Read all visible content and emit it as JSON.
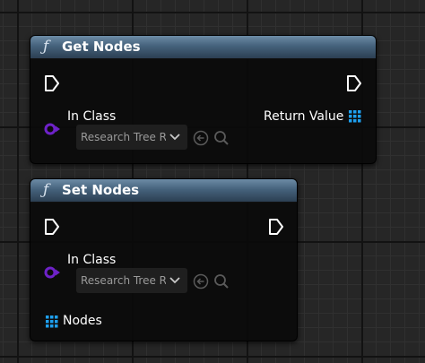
{
  "colors": {
    "graph_background": "#262626",
    "header_gradient_top": "#6c8ba5",
    "header_gradient_bottom": "#2c3f52",
    "class_pin": "#6e22c8",
    "array_pin": "#1ea0f0",
    "exec_pin": "#ffffff"
  },
  "get_node": {
    "title": "Get Nodes",
    "icon": "function-icon",
    "input_label": "In Class",
    "class_value": "Research Tree R",
    "output_label": "Return Value"
  },
  "set_node": {
    "title": "Set Nodes",
    "icon": "function-icon",
    "input_label": "In Class",
    "class_value": "Research Tree R",
    "nodes_label": "Nodes"
  },
  "icons": {
    "function": "ƒ",
    "exec": "exec-pin-icon",
    "class": "class-pin-icon",
    "array": "array-grid-icon",
    "browse_back": "arrow-left-circle-icon",
    "search": "search-icon",
    "dropdown": "chevron-down-icon"
  }
}
